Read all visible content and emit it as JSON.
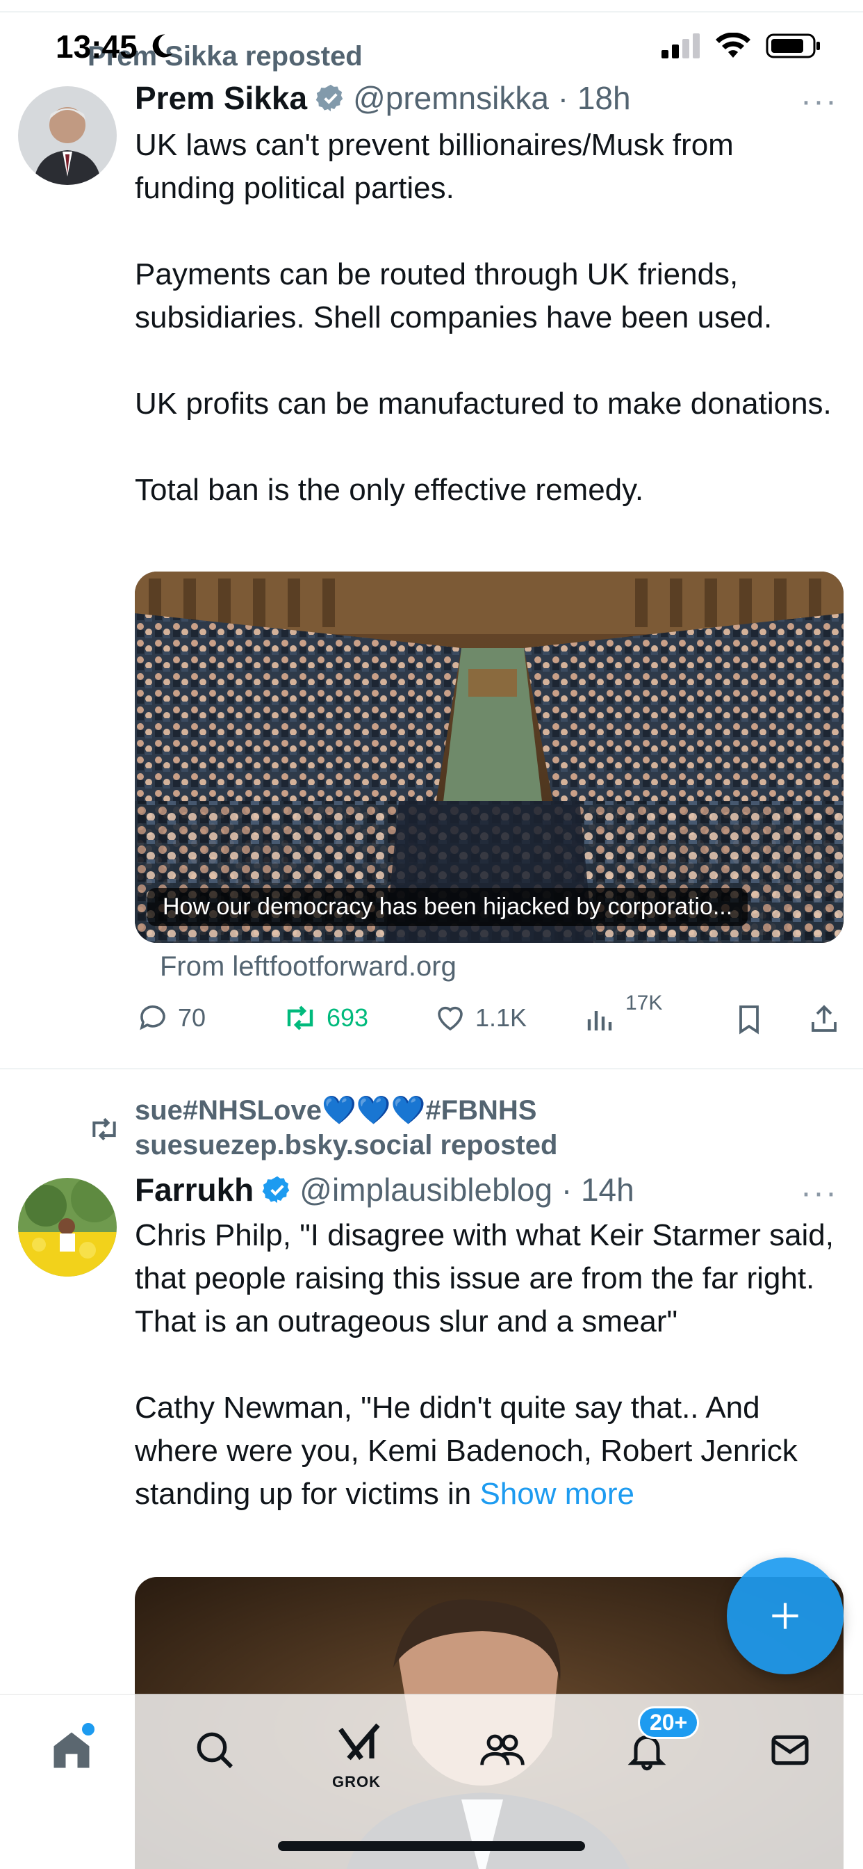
{
  "status_bar": {
    "time": "13:45"
  },
  "tweets": [
    {
      "repost_label": "Prem Sikka reposted",
      "name": "Prem Sikka",
      "handle": "@premnsikka",
      "time": "18h",
      "paragraphs": [
        "UK laws can't prevent billionaires/Musk from funding political parties.",
        "Payments can be routed through UK friends, subsidiaries. Shell companies have been used.",
        "UK profits can be manufactured to make donations.",
        "Total ban is the only effective remedy."
      ],
      "link_card": {
        "caption": "How our democracy has been hijacked by corporatio...",
        "source": "From leftfootforward.org"
      },
      "counts": {
        "replies": "70",
        "reposts": "693",
        "likes": "1.1K",
        "views": "17K"
      }
    },
    {
      "repost_label_line1": "sue#NHSLove💙💙💙#FBNHS",
      "repost_label_line2": "suesuezep.bsky.social reposted",
      "name": "Farrukh",
      "handle": "@implausibleblog",
      "time": "14h",
      "paragraphs": [
        "Chris Philp, \"I disagree with what Keir Starmer said, that people raising this issue are from the far right. That is an outrageous slur and a smear\"",
        "Cathy Newman, \"He didn't quite say that.. And where were you, Kemi Badenoch, Robert Jenrick standing up for victims in"
      ],
      "show_more": "Show more"
    }
  ],
  "tab_bar": {
    "grok_label": "GROK",
    "notifications_badge": "20+"
  },
  "colors": {
    "accent": "#1d9bf0",
    "repost_green": "#00ba7c",
    "secondary_text": "#536471"
  },
  "icons": [
    "moon-icon",
    "signal-icon",
    "wifi-icon",
    "battery-icon",
    "repost-icon",
    "verified-icon",
    "more-icon",
    "reply-icon",
    "like-icon",
    "views-icon",
    "bookmark-icon",
    "share-icon",
    "compose-icon",
    "home-icon",
    "search-icon",
    "grok-icon",
    "communities-icon",
    "notifications-icon",
    "messages-icon"
  ]
}
